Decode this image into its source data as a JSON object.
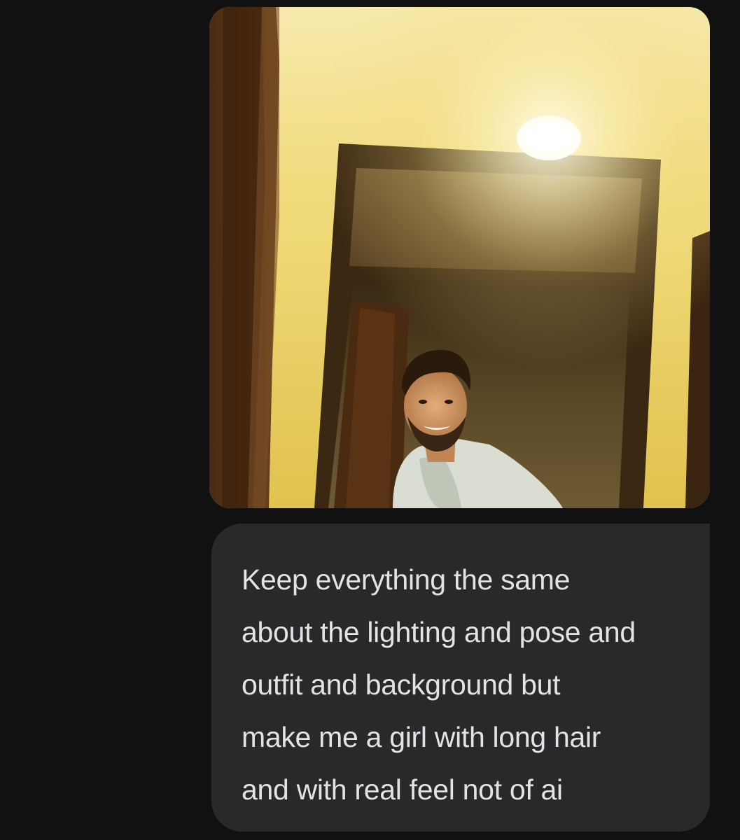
{
  "chat": {
    "user_message": {
      "attachment": {
        "type": "photo",
        "subject": "person-icon"
      },
      "text_lines": [
        "Keep everything the same",
        "about the lighting and pose and",
        "outfit and background but",
        "make me a girl with long hair",
        "and with real feel not of ai"
      ]
    }
  },
  "colors": {
    "background": "#111112",
    "bubble": "#28292b",
    "text": "#e3e3e3"
  }
}
